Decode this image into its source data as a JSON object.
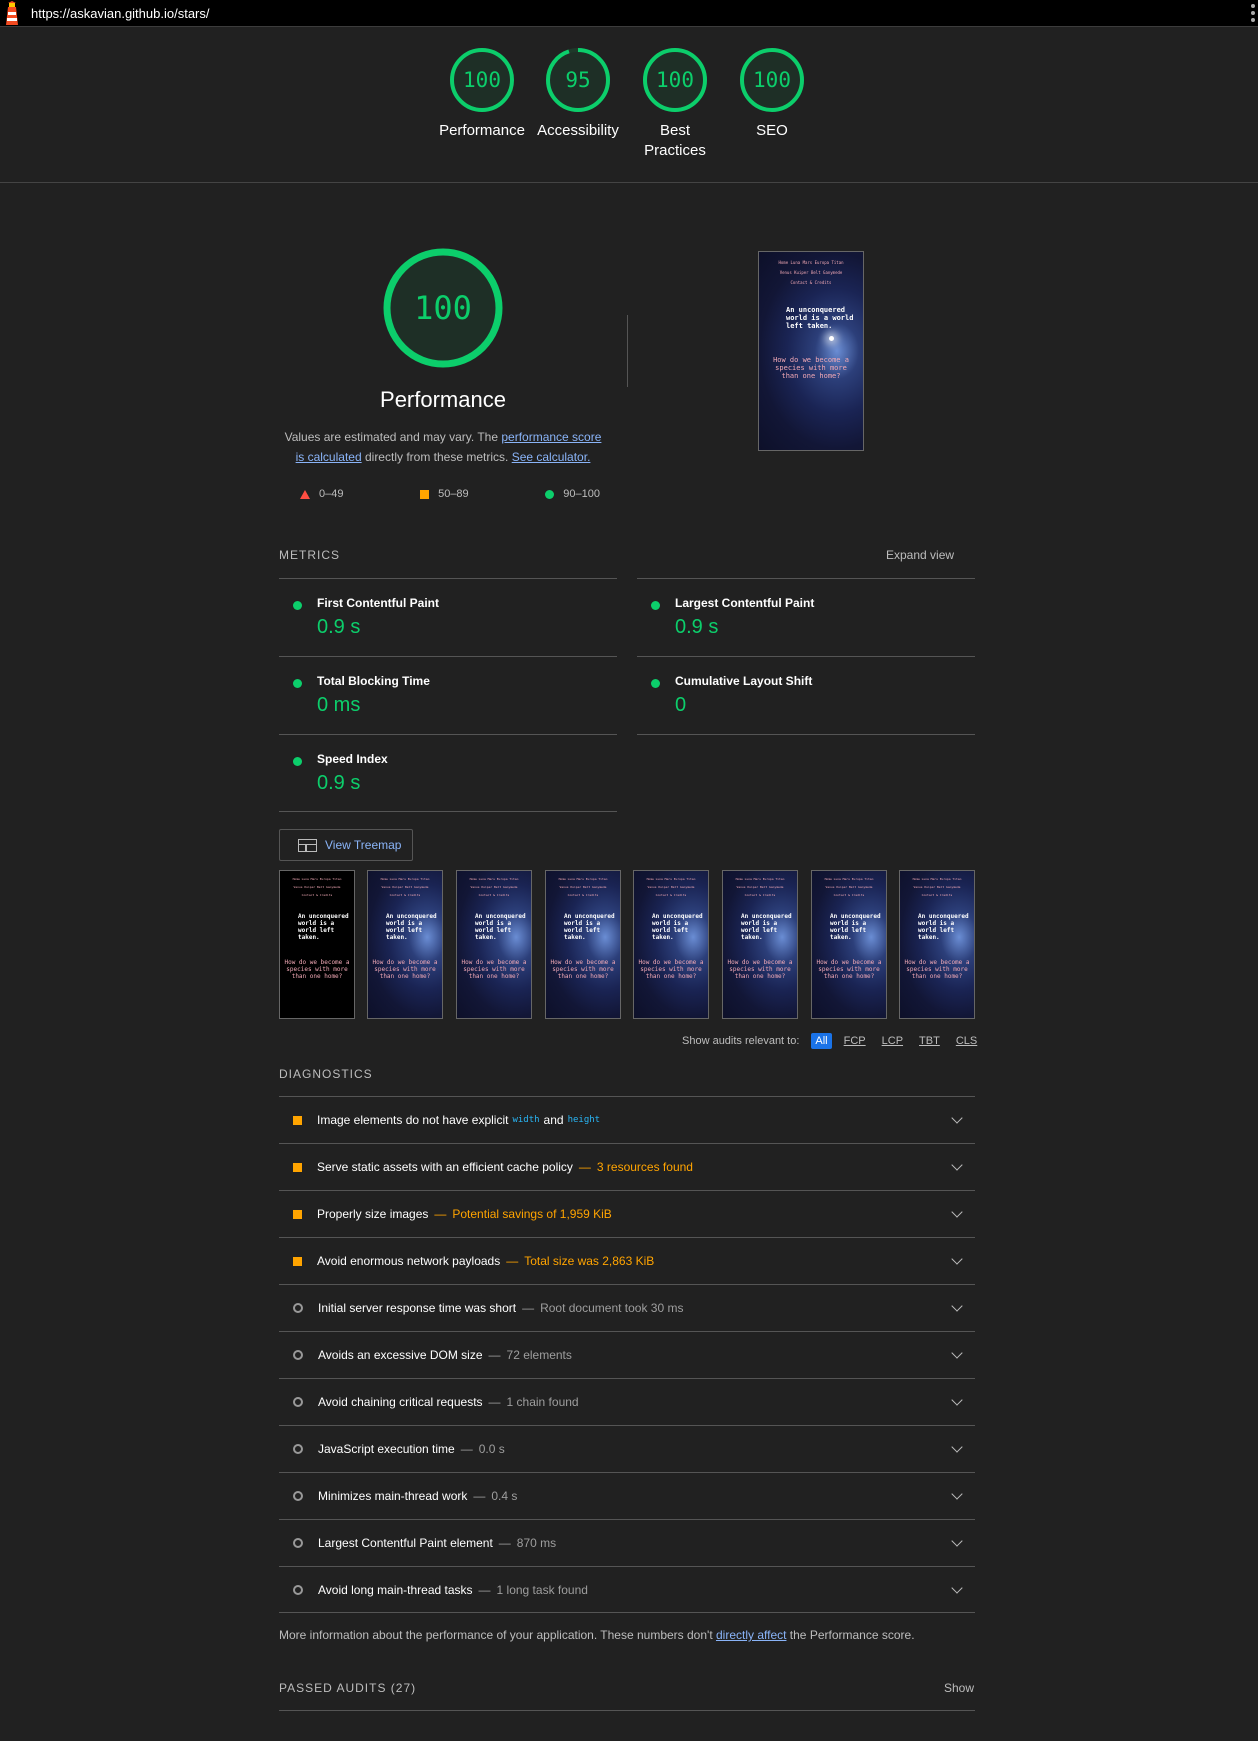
{
  "url": "https://askavian.github.io/stars/",
  "colors": {
    "pass": "#0cce6b",
    "average": "#ffa400",
    "fail": "#ff4e42",
    "link": "#8ab4f8"
  },
  "categories": [
    {
      "score": 100,
      "label": "Performance"
    },
    {
      "score": 95,
      "label": "Accessibility"
    },
    {
      "score": 100,
      "label": "Best Practices"
    },
    {
      "score": 100,
      "label": "SEO"
    }
  ],
  "performance": {
    "score": 100,
    "title": "Performance",
    "desc_1": "Values are estimated and may vary. The ",
    "link_1": "performance score is calculated",
    "desc_2": " directly from these metrics. ",
    "link_2": "See calculator.",
    "legend": {
      "fail": "0–49",
      "average": "50–89",
      "pass": "90–100"
    }
  },
  "screenshot": {
    "nav_1": "Home Luna Mars Europa Titan",
    "nav_2": "Venus Kuiper Belt Ganymede",
    "nav_3": "Contact & Credits",
    "heading": "An unconquered world is a world left taken.",
    "subheading": "How do we become a species with more than one home?"
  },
  "metrics": {
    "label": "METRICS",
    "expand": "Expand view",
    "items": [
      {
        "name": "First Contentful Paint",
        "value": "0.9 s"
      },
      {
        "name": "Largest Contentful Paint",
        "value": "0.9 s"
      },
      {
        "name": "Total Blocking Time",
        "value": "0 ms"
      },
      {
        "name": "Cumulative Layout Shift",
        "value": "0"
      },
      {
        "name": "Speed Index",
        "value": "0.9 s"
      }
    ]
  },
  "treemap_label": "View Treemap",
  "filter": {
    "label": "Show audits relevant to:",
    "chips": [
      "All",
      "FCP",
      "LCP",
      "TBT",
      "CLS"
    ]
  },
  "diagnostics": {
    "label": "DIAGNOSTICS",
    "items": [
      {
        "title": "Image elements do not have explicit",
        "code_1": "width",
        "and": "and",
        "code_2": "height"
      },
      {
        "title": "Serve static assets with an efficient cache policy",
        "display": "3 resources found"
      },
      {
        "title": "Properly size images",
        "display": "Potential savings of 1,959 KiB"
      },
      {
        "title": "Avoid enormous network payloads",
        "display": "Total size was 2,863 KiB"
      },
      {
        "title": "Initial server response time was short",
        "display": "Root document took 30 ms"
      },
      {
        "title": "Avoids an excessive DOM size",
        "display": "72 elements"
      },
      {
        "title": "Avoid chaining critical requests",
        "display": "1 chain found"
      },
      {
        "title": "JavaScript execution time",
        "display": "0.0 s"
      },
      {
        "title": "Minimizes main-thread work",
        "display": "0.4 s"
      },
      {
        "title": "Largest Contentful Paint element",
        "display": "870 ms"
      },
      {
        "title": "Avoid long main-thread tasks",
        "display": "1 long task found"
      }
    ]
  },
  "more_info": {
    "before": "More information about the performance of your application. These numbers don't ",
    "link": "directly affect",
    "after": " the Performance score."
  },
  "passed": {
    "label": "PASSED AUDITS (27)",
    "show": "Show"
  }
}
